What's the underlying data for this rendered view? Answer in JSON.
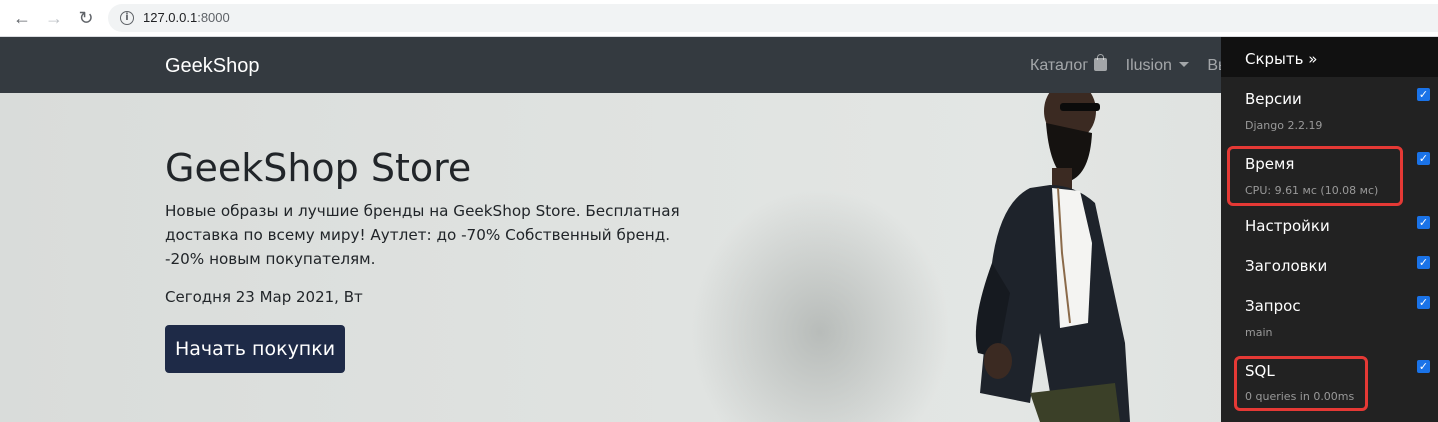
{
  "browser": {
    "url_host": "127.0.0.1",
    "url_port": ":8000"
  },
  "navbar": {
    "brand": "GeekShop",
    "catalog": "Каталог",
    "user": "Ilusion",
    "logout": "Вы"
  },
  "hero": {
    "title": "GeekShop Store",
    "text": "Новые образы и лучшие бренды на GeekShop Store. Бесплатная доставка по всему миру! Аутлет: до -70% Собственный бренд. -20% новым покупателям.",
    "date": "Сегодня 23 Мар 2021, Вт",
    "cta": "Начать покупки"
  },
  "debug_toolbar": {
    "hide": "Скрыть »",
    "panels": [
      {
        "title": "Версии",
        "subtitle": "Django 2.2.19",
        "checked": true
      },
      {
        "title": "Время",
        "subtitle": "CPU: 9.61 мс (10.08 мс)",
        "checked": true,
        "highlighted": true
      },
      {
        "title": "Настройки",
        "subtitle": "",
        "checked": true
      },
      {
        "title": "Заголовки",
        "subtitle": "",
        "checked": true
      },
      {
        "title": "Запрос",
        "subtitle": "main",
        "checked": true
      },
      {
        "title": "SQL",
        "subtitle": "0 queries in 0.00ms",
        "checked": true,
        "highlighted": true
      }
    ]
  },
  "colors": {
    "navbar": "#343a40",
    "cta": "#1e2a47",
    "highlight": "#e53935",
    "checkbox": "#1a73e8"
  }
}
